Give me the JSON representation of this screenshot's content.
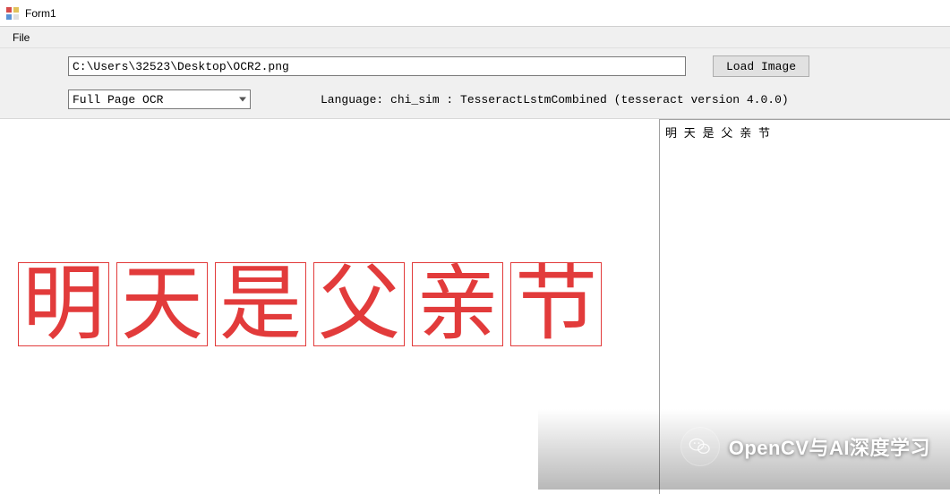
{
  "window": {
    "title": "Form1"
  },
  "menubar": {
    "file": "File"
  },
  "toolbar": {
    "path_value": "C:\\Users\\32523\\Desktop\\OCR2.png",
    "load_label": "Load Image",
    "mode_value": "Full Page OCR",
    "language_label": "Language:  chi_sim : TesseractLstmCombined (tesseract version 4.0.0)"
  },
  "image": {
    "chars": [
      "明",
      "天",
      "是",
      "父",
      "亲",
      "节"
    ]
  },
  "result": {
    "text": "明 天 是 父 亲 节"
  },
  "watermark": {
    "text": "OpenCV与AI深度学习"
  }
}
